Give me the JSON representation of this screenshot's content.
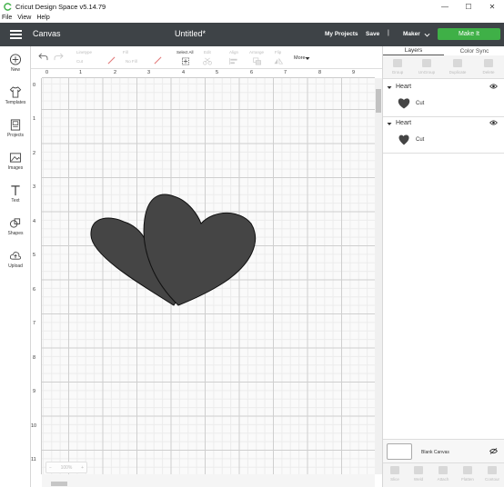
{
  "window": {
    "title": "Cricut Design Space  v5.14.79",
    "minimize": "—",
    "maximize": "☐",
    "close": "✕"
  },
  "menu": [
    "File",
    "View",
    "Help"
  ],
  "header": {
    "section": "Canvas",
    "document_title": "Untitled*",
    "my_projects": "My Projects",
    "save": "Save",
    "separator": "|",
    "machine": "Maker",
    "make_button": "Make It"
  },
  "sidebar": [
    {
      "label": "New",
      "icon": "plus-circle-icon"
    },
    {
      "label": "Templates",
      "icon": "shirt-icon"
    },
    {
      "label": "Projects",
      "icon": "projects-icon"
    },
    {
      "label": "Images",
      "icon": "image-icon"
    },
    {
      "label": "Text",
      "icon": "text-icon"
    },
    {
      "label": "Shapes",
      "icon": "shapes-icon"
    },
    {
      "label": "Upload",
      "icon": "upload-icon"
    }
  ],
  "toolbar": {
    "linetype_label": "Linetype",
    "linetype_value": "Cut",
    "fill_label": "Fill",
    "fill_value": "No Fill",
    "select_all": "Select All",
    "edit": "Edit",
    "align": "Align",
    "arrange": "Arrange",
    "flip": "Flip",
    "more": "More"
  },
  "ruler": {
    "horizontal": [
      "0",
      "1",
      "2",
      "3",
      "4",
      "5",
      "6",
      "7",
      "8",
      "9"
    ],
    "vertical": [
      "0",
      "1",
      "2",
      "3",
      "4",
      "5",
      "6",
      "7",
      "8",
      "9",
      "10",
      "11"
    ]
  },
  "zoom": {
    "minus": "−",
    "value": "100%",
    "plus": "+"
  },
  "canvas": {
    "shape_fill": "#454545",
    "shape_stroke": "#111111"
  },
  "right_panel": {
    "tabs": [
      "Layers",
      "Color Sync"
    ],
    "tools": [
      "Group",
      "UnGroup",
      "Duplicate",
      "Delete"
    ],
    "layers": [
      {
        "name": "Heart",
        "operation": "Cut"
      },
      {
        "name": "Heart",
        "operation": "Cut"
      }
    ],
    "blank_canvas": "Blank Canvas",
    "bottom_tools": [
      "Slice",
      "Weld",
      "Attach",
      "Flatten",
      "Contour"
    ]
  },
  "colors": {
    "header_bg": "#3e4347",
    "make_button": "#3fb047"
  }
}
